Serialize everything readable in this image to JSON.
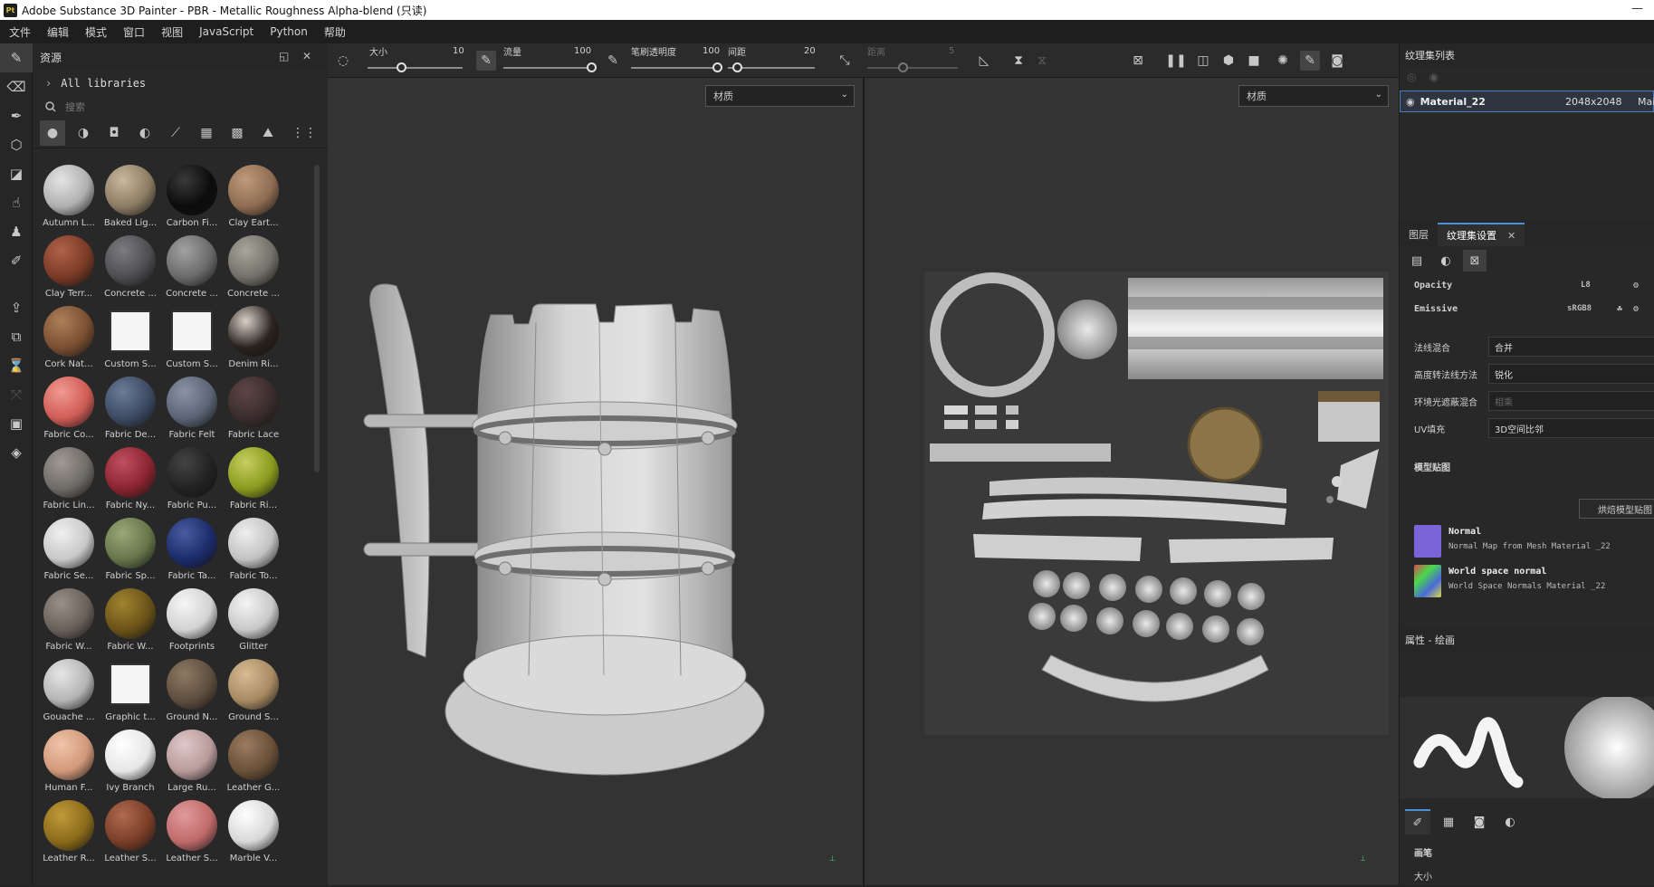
{
  "window": {
    "title": "Adobe Substance 3D Painter - PBR - Metallic Roughness Alpha-blend (只读)",
    "logo": "Pt",
    "minimize": "—"
  },
  "menu": [
    "文件",
    "编辑",
    "模式",
    "窗口",
    "视图",
    "JavaScript",
    "Python",
    "帮助"
  ],
  "tools": [
    "paint-brush",
    "eraser",
    "projection",
    "geometry-mask",
    "polygon-fill",
    "smudge",
    "clone-stamp",
    "color-picker",
    "export",
    "bake",
    "history",
    "warp",
    "sync",
    "layers"
  ],
  "assets": {
    "title": "资源",
    "libraries": "All libraries",
    "search_placeholder": "搜索",
    "items": [
      {
        "label": "Autumn L...",
        "color": "#b0b0b0",
        "hl": "#e4e4e4"
      },
      {
        "label": "Baked Lig...",
        "color": "#8c7c64",
        "hl": "#c9b89e"
      },
      {
        "label": "Carbon Fi...",
        "color": "#0c0c0c",
        "hl": "#3a3a3a"
      },
      {
        "label": "Clay Eart...",
        "color": "#8f6c52",
        "hl": "#bf9a7a"
      },
      {
        "label": "Clay Terr...",
        "color": "#7a3a26",
        "hl": "#b0634a"
      },
      {
        "label": "Concrete ...",
        "color": "#4d4d52",
        "hl": "#7b7b80"
      },
      {
        "label": "Concrete ...",
        "color": "#6a6a6a",
        "hl": "#a2a2a2"
      },
      {
        "label": "Concrete ...",
        "color": "#727068",
        "hl": "#a8a69c"
      },
      {
        "label": "Cork Nat...",
        "color": "#7a4f32",
        "hl": "#ad8058"
      },
      {
        "label": "Custom S...",
        "color": "#ffffff",
        "hl": "#ffffff"
      },
      {
        "label": "Custom S...",
        "color": "#ffffff",
        "hl": "#ffffff"
      },
      {
        "label": "Denim Ri...",
        "color": "#2a221e",
        "hl": "#d8d0c8"
      },
      {
        "label": "Fabric Co...",
        "color": "#d05c56",
        "hl": "#f09a90"
      },
      {
        "label": "Fabric De...",
        "color": "#3c4a62",
        "hl": "#6c7c98"
      },
      {
        "label": "Fabric Felt",
        "color": "#5a6474",
        "hl": "#8a94a4"
      },
      {
        "label": "Fabric Lace",
        "color": "#3a2c2c",
        "hl": "#5e4646"
      },
      {
        "label": "Fabric Lin...",
        "color": "#6e6a66",
        "hl": "#a09a94"
      },
      {
        "label": "Fabric Ny...",
        "color": "#8a2430",
        "hl": "#c05060"
      },
      {
        "label": "Fabric Pu...",
        "color": "#222222",
        "hl": "#444444"
      },
      {
        "label": "Fabric Ri...",
        "color": "#8a9a1e",
        "hl": "#c4d060"
      },
      {
        "label": "Fabric Se...",
        "color": "#c8c8c8",
        "hl": "#f0f0f0"
      },
      {
        "label": "Fabric Sp...",
        "color": "#66764a",
        "hl": "#98a878"
      },
      {
        "label": "Fabric Ta...",
        "color": "#1c2c6a",
        "hl": "#4a5ca0"
      },
      {
        "label": "Fabric To...",
        "color": "#c2c2c2",
        "hl": "#eeeeee"
      },
      {
        "label": "Fabric W...",
        "color": "#6a605a",
        "hl": "#9a908a"
      },
      {
        "label": "Fabric W...",
        "color": "#6a5218",
        "hl": "#a08430"
      },
      {
        "label": "Footprints",
        "color": "#d2d2d2",
        "hl": "#f6f6f6"
      },
      {
        "label": "Glitter",
        "color": "#c8c8c8",
        "hl": "#f4f4f4"
      },
      {
        "label": "Gouache ...",
        "color": "#b4b4b4",
        "hl": "#e6e6e6"
      },
      {
        "label": "Graphic t...",
        "color": "#ffffff",
        "hl": "#ffffff"
      },
      {
        "label": "Ground N...",
        "color": "#5e4e3e",
        "hl": "#8e7a64"
      },
      {
        "label": "Ground S...",
        "color": "#a88a62",
        "hl": "#d6bc92"
      },
      {
        "label": "Human F...",
        "color": "#d2987a",
        "hl": "#f0c4aa"
      },
      {
        "label": "Ivy Branch",
        "color": "#e6e6e6",
        "hl": "#ffffff"
      },
      {
        "label": "Large Ru...",
        "color": "#b89a9a",
        "hl": "#e0c8c8"
      },
      {
        "label": "Leather G...",
        "color": "#6a5038",
        "hl": "#9a7c60"
      },
      {
        "label": "Leather R...",
        "color": "#8a6a1a",
        "hl": "#c09a3a"
      },
      {
        "label": "Leather S...",
        "color": "#7a3e28",
        "hl": "#b06a50"
      },
      {
        "label": "Leather S...",
        "color": "#c06a6a",
        "hl": "#e09a9a"
      },
      {
        "label": "Marble V...",
        "color": "#d8d8d8",
        "hl": "#ffffff"
      }
    ]
  },
  "toolbar": {
    "size": {
      "label": "大小",
      "value": "10"
    },
    "flow": {
      "label": "流量",
      "value": "100"
    },
    "stroke_opacity": {
      "label": "笔刷透明度",
      "value": "100"
    },
    "spacing": {
      "label": "间距",
      "value": "20"
    },
    "distance": {
      "label": "距离",
      "value": "5"
    }
  },
  "viewport": {
    "left_dropdown": "材质",
    "right_dropdown": "材质"
  },
  "texture_sets": {
    "title": "纹理集列表",
    "rows": [
      {
        "name": "Material_22",
        "resolution": "2048x2048",
        "extra": "Mai"
      }
    ]
  },
  "settings": {
    "tabs": [
      "图层",
      "纹理集设置"
    ],
    "opacity": {
      "label": "Opacity",
      "value": "L8"
    },
    "emissive": {
      "label": "Emissive",
      "value": "sRGB8"
    },
    "normal_blend": {
      "label": "法线混合",
      "value": "合并"
    },
    "height_to_normal": {
      "label": "高度转法线方法",
      "value": "锐化"
    },
    "ao_blend": {
      "label": "环境光遮蔽混合",
      "value": "相乘"
    },
    "uv_fill": {
      "label": "UV填充",
      "value": "3D空间比邻"
    },
    "mesh_maps_title": "模型贴图",
    "bake_button": "烘焙模型贴图",
    "maps": [
      {
        "title": "Normal",
        "sub": "Normal Map from Mesh Material _22"
      },
      {
        "title": "World space normal",
        "sub": "World Space Normals Material _22"
      }
    ]
  },
  "properties": {
    "title": "属性 - 绘画",
    "brush_section": "画笔",
    "size_label": "大小"
  }
}
